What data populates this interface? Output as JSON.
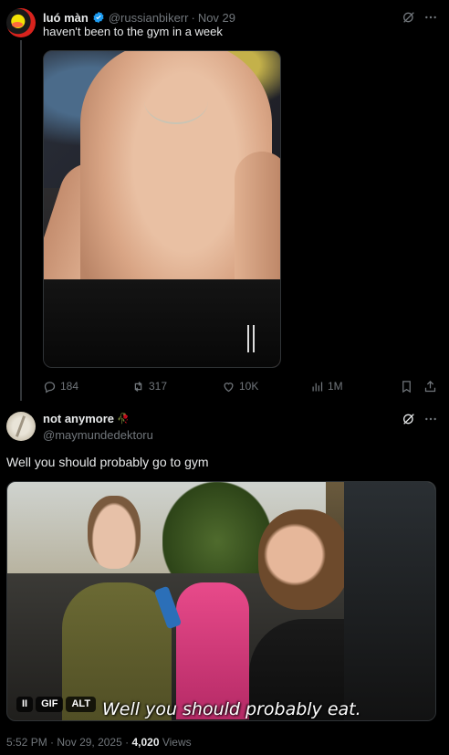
{
  "tweet1": {
    "name": "luó màn",
    "handle": "@russianbikerr",
    "separator": "·",
    "date": "Nov 29",
    "text": "haven't been to the gym in a week",
    "stats": {
      "replies": "184",
      "reposts": "317",
      "likes": "10K",
      "views": "1M"
    },
    "icons": [
      "grok-icon",
      "more-icon",
      "reply-icon",
      "repost-icon",
      "like-icon",
      "views-icon",
      "bookmark-icon",
      "share-icon",
      "verified-icon"
    ]
  },
  "tweet2": {
    "name": "not anymore",
    "name_emoji": "🥀",
    "handle": "@maymundedektoru",
    "text": "Well you should probably go to gym",
    "media": {
      "caption": "Well you should probably eat.",
      "pause_label": "II",
      "gif_label": "GIF",
      "alt_label": "ALT"
    },
    "meta": {
      "time": "5:52 PM",
      "separator": "·",
      "date": "Nov 29, 2025",
      "separator2": "·",
      "views_count": "4,020",
      "views_label": "Views"
    }
  },
  "colors": {
    "background": "#000000",
    "text_primary": "#e7e9ea",
    "text_secondary": "#71767b",
    "verified_blue": "#1d9bf0",
    "divider": "#2f3336"
  }
}
